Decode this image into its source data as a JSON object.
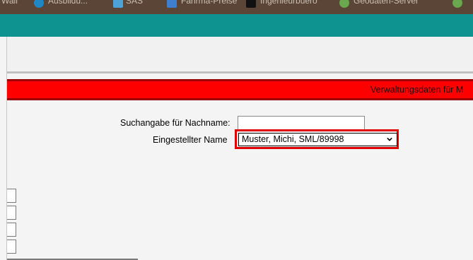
{
  "bookmarks": [
    {
      "label": "Wall"
    },
    {
      "label": "Ausbildu..."
    },
    {
      "label": "SAS"
    },
    {
      "label": "Fahrma-Preise"
    },
    {
      "label": "Ingenieurbuero"
    },
    {
      "label": "Geodaten-Server"
    }
  ],
  "colors": {
    "bookmark_bar": "#5a4536",
    "teal_bar": "#0e9390",
    "red_band": "#ff0000",
    "highlight": "#e00000"
  },
  "banner": {
    "text": "Verwaltungsdaten für M"
  },
  "form": {
    "search_label": "Suchangabe für Nachname:",
    "search_value": "",
    "name_label": "Eingestellter Name",
    "name_selected": "Muster, Michi, SML/89998"
  }
}
